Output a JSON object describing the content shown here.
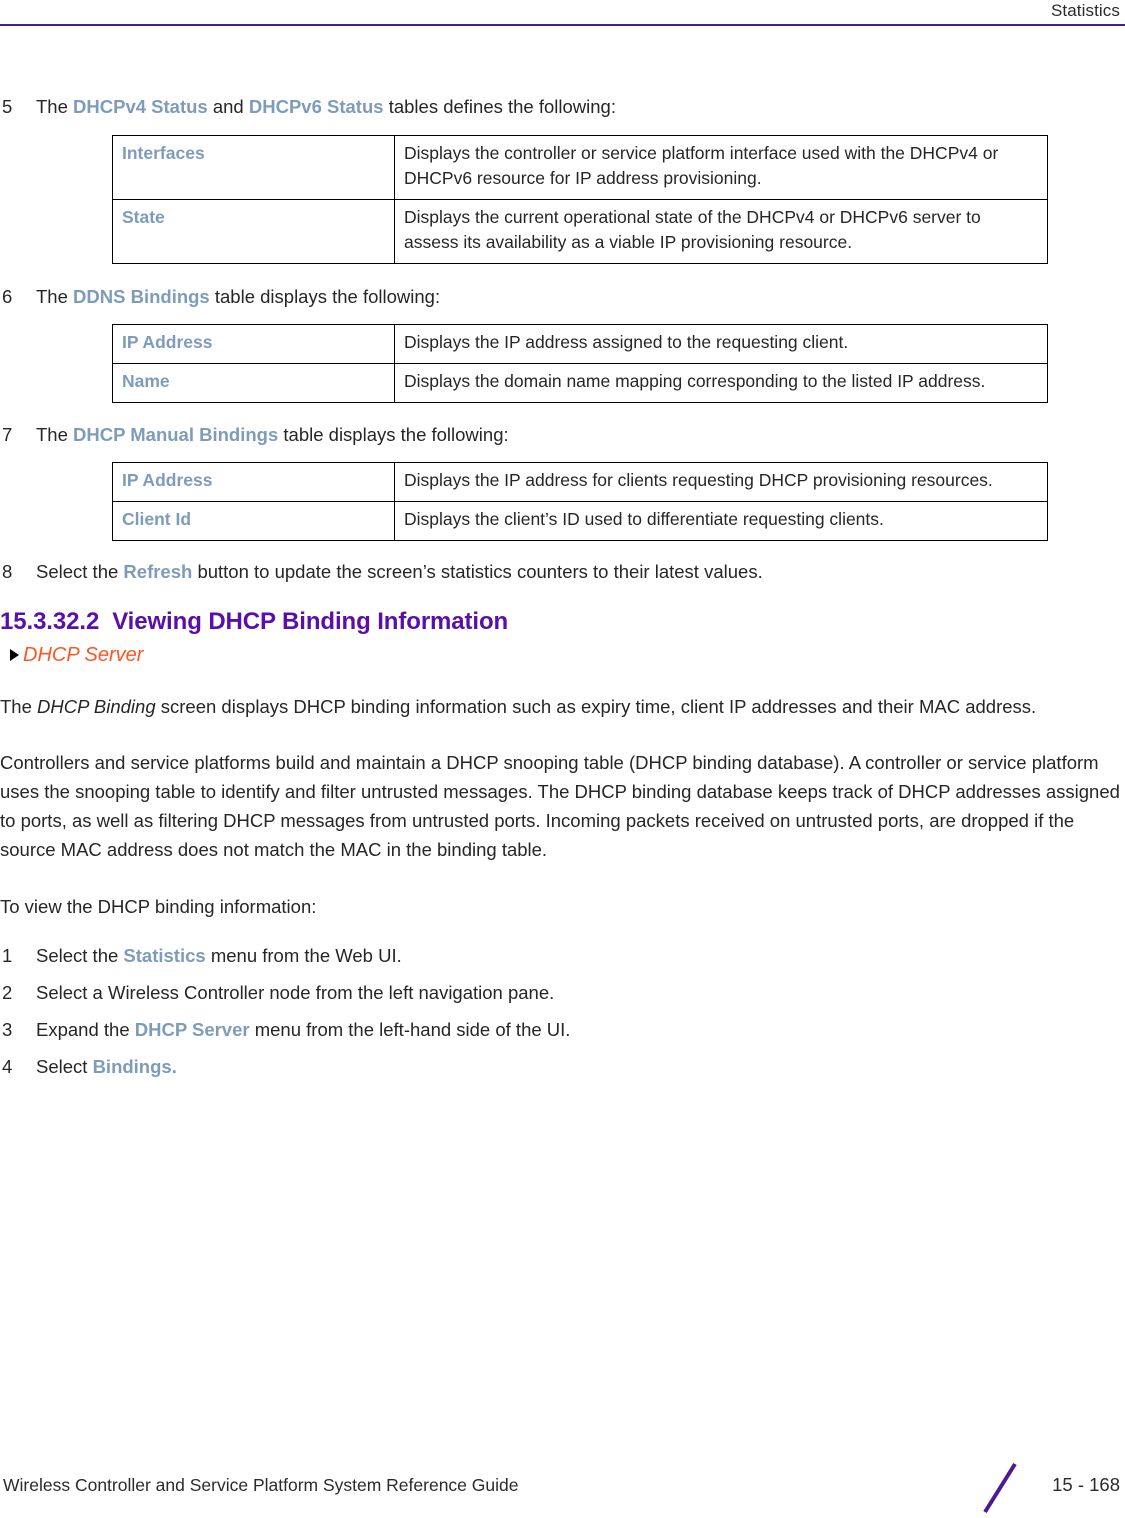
{
  "header": {
    "title": "Statistics",
    "rule_color": "#4f1b8c"
  },
  "colors": {
    "keyword_blue": "#7e9cba",
    "heading_purple": "#5a0fa8",
    "xref_orange": "#ff5522",
    "rule_purple": "#4f1b8c"
  },
  "steps": {
    "step5": {
      "num": "5",
      "pre": "The ",
      "kw1": "DHCPv4 Status",
      "mid": " and ",
      "kw2": "DHCPv6 Status",
      "post": " tables defines the following:"
    },
    "step6": {
      "num": "6",
      "pre": "The ",
      "kw1": "DDNS Bindings",
      "post": " table displays the following:"
    },
    "step7": {
      "num": "7",
      "pre": "The ",
      "kw1": "DHCP Manual Bindings",
      "post": " table displays the following:"
    },
    "step8": {
      "num": "8",
      "pre": "Select the ",
      "kw1": "Refresh",
      "post": " button to update the screen’s statistics counters to their latest values."
    }
  },
  "tables": {
    "dhcp_status": {
      "rows": [
        {
          "term": "Interfaces",
          "description": "Displays the controller or service platform interface used with the DHCPv4 or DHCPv6 resource for IP address provisioning."
        },
        {
          "term": "State",
          "description": "Displays the current operational state of the DHCPv4 or DHCPv6 server to assess its availability as a viable IP provisioning resource."
        }
      ]
    },
    "ddns_bindings": {
      "rows": [
        {
          "term": "IP Address",
          "description": "Displays the IP address assigned to the requesting client."
        },
        {
          "term": "Name",
          "description": "Displays the domain name mapping corresponding to the listed IP address."
        }
      ]
    },
    "dhcp_manual_bindings": {
      "rows": [
        {
          "term": "IP Address",
          "description": "Displays the IP address for clients requesting DHCP provisioning resources."
        },
        {
          "term": "Client Id",
          "description": "Displays the client’s ID used to differentiate requesting clients."
        }
      ]
    }
  },
  "section": {
    "number": "15.3.32.2",
    "title": "Viewing DHCP Binding Information",
    "breadcrumb": "DHCP Server"
  },
  "paragraphs": {
    "intro_pre": "The ",
    "intro_italic": "DHCP Binding",
    "intro_post": " screen displays DHCP binding information such as expiry time, client IP addresses and their MAC address.",
    "body2": "Controllers and service platforms build and maintain a DHCP snooping table (DHCP binding database). A controller or service platform uses the snooping table to identify and filter untrusted messages. The DHCP binding database keeps track of DHCP addresses assigned to ports, as well as filtering DHCP messages from untrusted ports. Incoming packets received on untrusted ports, are dropped if the source MAC address does not match the MAC in the binding table.",
    "lead_in": "To view the DHCP binding information:"
  },
  "procedure": [
    {
      "num": "1",
      "pre": "Select the ",
      "kw1": "Statistics",
      "post": " menu from the Web UI."
    },
    {
      "num": "2",
      "pre": "Select a Wireless Controller node from the left navigation pane.",
      "kw1": "",
      "post": ""
    },
    {
      "num": "3",
      "pre": "Expand the ",
      "kw1": "DHCP Server",
      "post": " menu from the left-hand side of the UI."
    },
    {
      "num": "4",
      "pre": "Select ",
      "kw1": "Bindings.",
      "post": ""
    }
  ],
  "footer": {
    "title": "Wireless Controller and Service Platform System Reference Guide",
    "page_number": "15 - 168"
  }
}
